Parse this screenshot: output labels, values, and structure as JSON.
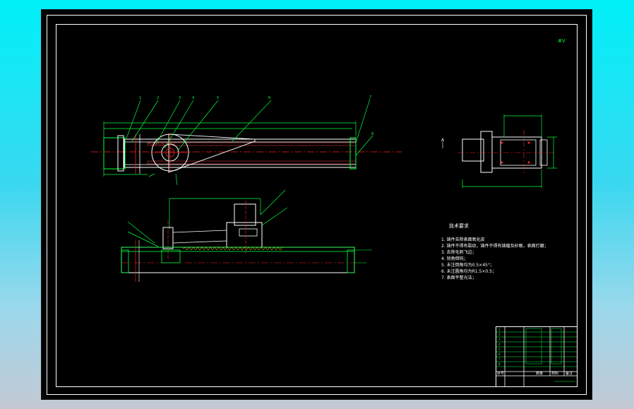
{
  "drawing": {
    "corner_mark": "#V",
    "tech_requirements": {
      "title": "技术要求",
      "items": [
        "1. 铸件去除表面氧化皮",
        "2. 铸件不得有裂纹，铸件不得有铸瘤及砂眼，表面打磨；",
        "3. 去除毛刺飞边；",
        "4. 锐角倒钝；",
        "5. 未注倒角均为0.5×45°；",
        "6. 未注圆角均为R1.5×0.5；",
        "7. 表面平整光洁；"
      ]
    },
    "title_block": {
      "hdr_seq": "序号",
      "hdr_qty": "数量",
      "hdr_mat": "材料",
      "hdr_note": "备注"
    }
  },
  "colors": {
    "background_gradient_top": "#00f0f8",
    "sheet": "#000000",
    "frame": "#ffffff",
    "outline_green": "#00ff3c",
    "hatch_yellow": "#ffff00",
    "centerline_red": "#ff2020",
    "dimension_cyan": "#00e0ff",
    "text_white": "#ffffff"
  },
  "icons": [
    "roughness-symbol-icon"
  ]
}
